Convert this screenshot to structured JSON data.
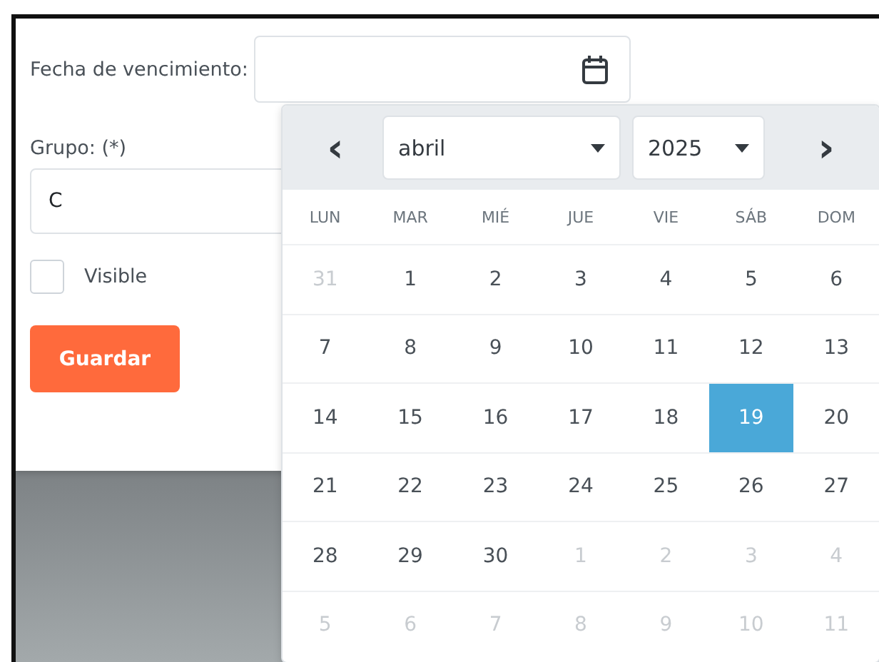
{
  "form": {
    "due_date": {
      "label": "Fecha de vencimiento:"
    },
    "group": {
      "label": "Grupo: (*)",
      "value": "C"
    },
    "visible": {
      "label": "Visible",
      "checked": false
    },
    "save_button": "Guardar"
  },
  "datepicker": {
    "prev": "‹",
    "next": "›",
    "month": "abril",
    "year": "2025",
    "weekdays": [
      "LUN",
      "MAR",
      "MIÉ",
      "JUE",
      "VIE",
      "SÁB",
      "DOM"
    ],
    "days": [
      {
        "label": "31",
        "muted": true,
        "selected": false
      },
      {
        "label": "1",
        "muted": false,
        "selected": false
      },
      {
        "label": "2",
        "muted": false,
        "selected": false
      },
      {
        "label": "3",
        "muted": false,
        "selected": false
      },
      {
        "label": "4",
        "muted": false,
        "selected": false
      },
      {
        "label": "5",
        "muted": false,
        "selected": false
      },
      {
        "label": "6",
        "muted": false,
        "selected": false
      },
      {
        "label": "7",
        "muted": false,
        "selected": false
      },
      {
        "label": "8",
        "muted": false,
        "selected": false
      },
      {
        "label": "9",
        "muted": false,
        "selected": false
      },
      {
        "label": "10",
        "muted": false,
        "selected": false
      },
      {
        "label": "11",
        "muted": false,
        "selected": false
      },
      {
        "label": "12",
        "muted": false,
        "selected": false
      },
      {
        "label": "13",
        "muted": false,
        "selected": false
      },
      {
        "label": "14",
        "muted": false,
        "selected": false
      },
      {
        "label": "15",
        "muted": false,
        "selected": false
      },
      {
        "label": "16",
        "muted": false,
        "selected": false
      },
      {
        "label": "17",
        "muted": false,
        "selected": false
      },
      {
        "label": "18",
        "muted": false,
        "selected": false
      },
      {
        "label": "19",
        "muted": false,
        "selected": true
      },
      {
        "label": "20",
        "muted": false,
        "selected": false
      },
      {
        "label": "21",
        "muted": false,
        "selected": false
      },
      {
        "label": "22",
        "muted": false,
        "selected": false
      },
      {
        "label": "23",
        "muted": false,
        "selected": false
      },
      {
        "label": "24",
        "muted": false,
        "selected": false
      },
      {
        "label": "25",
        "muted": false,
        "selected": false
      },
      {
        "label": "26",
        "muted": false,
        "selected": false
      },
      {
        "label": "27",
        "muted": false,
        "selected": false
      },
      {
        "label": "28",
        "muted": false,
        "selected": false
      },
      {
        "label": "29",
        "muted": false,
        "selected": false
      },
      {
        "label": "30",
        "muted": false,
        "selected": false
      },
      {
        "label": "1",
        "muted": true,
        "selected": false
      },
      {
        "label": "2",
        "muted": true,
        "selected": false
      },
      {
        "label": "3",
        "muted": true,
        "selected": false
      },
      {
        "label": "4",
        "muted": true,
        "selected": false
      },
      {
        "label": "5",
        "muted": true,
        "selected": false
      },
      {
        "label": "6",
        "muted": true,
        "selected": false
      },
      {
        "label": "7",
        "muted": true,
        "selected": false
      },
      {
        "label": "8",
        "muted": true,
        "selected": false
      },
      {
        "label": "9",
        "muted": true,
        "selected": false
      },
      {
        "label": "10",
        "muted": true,
        "selected": false
      },
      {
        "label": "11",
        "muted": true,
        "selected": false
      }
    ]
  }
}
